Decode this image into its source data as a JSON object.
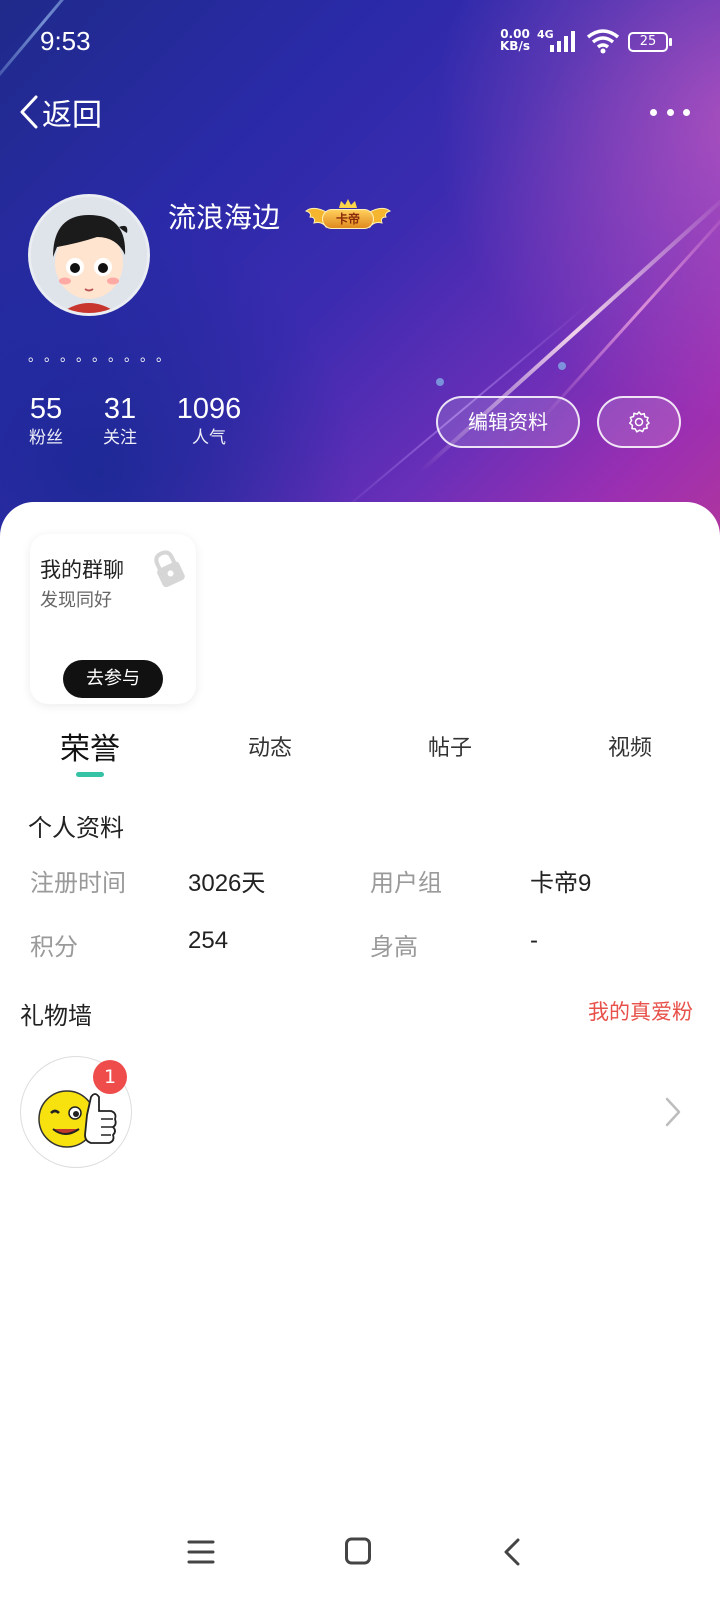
{
  "status_bar": {
    "time": "9:53",
    "net_speed_value": "0.00",
    "net_speed_unit": "KB/s",
    "net_type": "4G",
    "battery": "25"
  },
  "nav": {
    "back_label": "返回"
  },
  "profile": {
    "username": "流浪海边",
    "vip_label": "卡帝",
    "signature": "。。。。。。。。。",
    "stats": [
      {
        "value": "55",
        "label": "粉丝"
      },
      {
        "value": "31",
        "label": "关注"
      },
      {
        "value": "1096",
        "label": "人气"
      }
    ],
    "edit_label": "编辑资料"
  },
  "group_card": {
    "title": "我的群聊",
    "subtitle": "发现同好",
    "join_label": "去参与"
  },
  "tabs": [
    "荣誉",
    "动态",
    "帖子",
    "视频"
  ],
  "personal_info": {
    "title": "个人资料",
    "rows": [
      {
        "label1": "注册时间",
        "value1": "3026天",
        "label2": "用户组",
        "value2": "卡帝9"
      },
      {
        "label1": "积分",
        "value1": "254",
        "label2": "身高",
        "value2": "-"
      }
    ]
  },
  "gift_wall": {
    "title": "礼物墙",
    "link": "我的真爱粉",
    "items": [
      {
        "icon": "thumbs-up-wink-emoji",
        "count": "1"
      }
    ]
  },
  "colors": {
    "accent_tab": "#36c2a5",
    "gift_link": "#e8504a",
    "badge_red": "#ef4c4c"
  }
}
